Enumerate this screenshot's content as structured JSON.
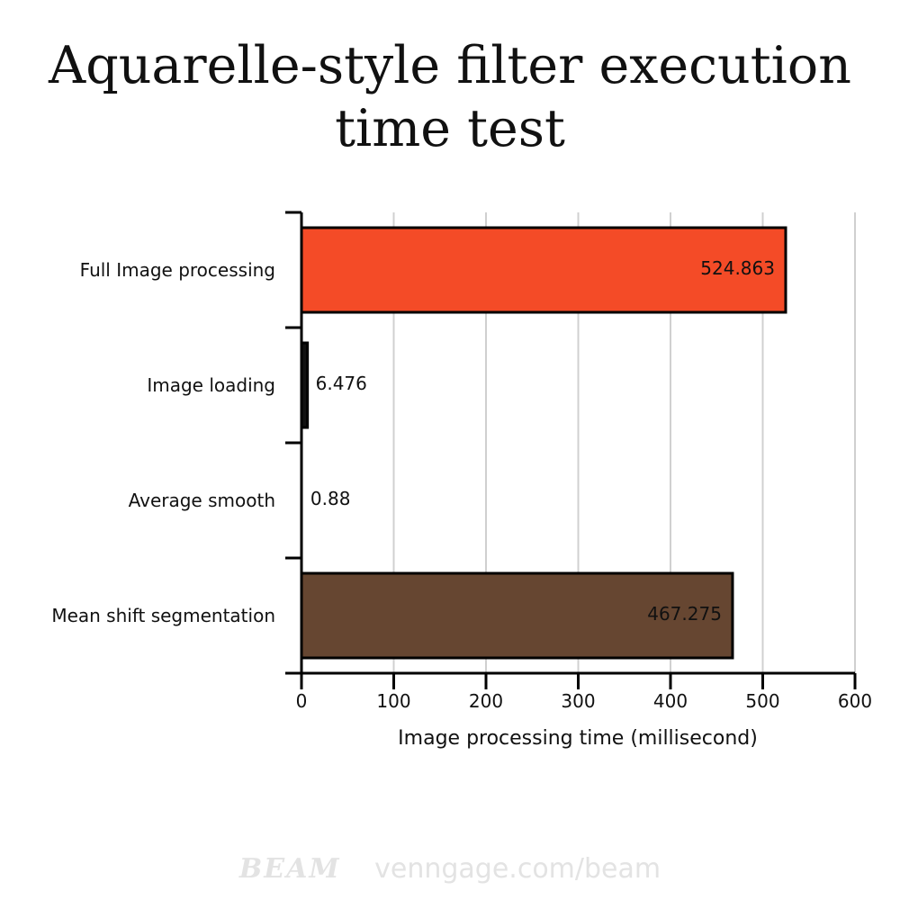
{
  "chart_data": {
    "type": "bar",
    "orientation": "horizontal",
    "title": "Aquarelle-style filter execution time test",
    "xlabel": "Image processing time (millisecond)",
    "ylabel": "",
    "categories": [
      "Full Image processing",
      "Image loading",
      "Average smooth",
      "Mean shift segmentation"
    ],
    "values": [
      524.863,
      6.476,
      0.88,
      467.275
    ],
    "value_labels": [
      "524.863",
      "6.476",
      "0.88",
      "467.275"
    ],
    "colors": [
      "#f44b27",
      "#111111",
      "#111111",
      "#664631"
    ],
    "xlim": [
      0,
      600
    ],
    "xticks": [
      "0",
      "100",
      "200",
      "300",
      "400",
      "500",
      "600"
    ],
    "grid": true,
    "legend": "none"
  },
  "footer": {
    "logo": "BEAM",
    "url": "venngage.com/beam"
  }
}
